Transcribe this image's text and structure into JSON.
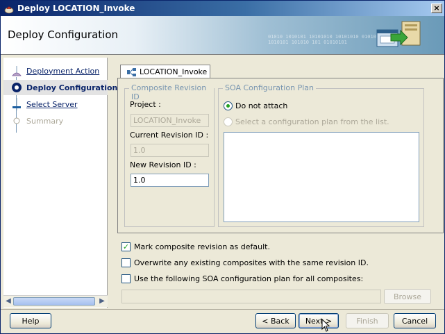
{
  "window": {
    "title": "Deploy LOCATION_Invoke",
    "close_label": "×"
  },
  "banner": {
    "title": "Deploy Configuration",
    "binary_text": "01010 1010101 10101010 10101010 01010 1010101 101010 101 01010101"
  },
  "steps": [
    {
      "label": "Deployment Action",
      "state": "link"
    },
    {
      "label": "Deploy Configuration",
      "state": "current"
    },
    {
      "label": "Select Server",
      "state": "link"
    },
    {
      "label": "Summary",
      "state": "muted"
    }
  ],
  "tab": {
    "label": "LOCATION_Invoke",
    "icon": "composite-icon"
  },
  "composite_revision": {
    "title": "Composite Revision ID",
    "project_label": "Project :",
    "project_value": "LOCATION_Invoke",
    "current_label": "Current Revision ID :",
    "current_value": "1.0",
    "new_label": "New Revision ID :",
    "new_value": "1.0"
  },
  "soa_plan": {
    "title": "SOA Configuration Plan",
    "option_do_not_attach": "Do not attach",
    "option_select_plan": "Select a configuration plan from the list.",
    "selected": "do_not_attach"
  },
  "options": {
    "mark_default": {
      "label": "Mark composite revision as default.",
      "checked": true
    },
    "overwrite": {
      "label": "Overwrite any existing composites with the same revision ID.",
      "checked": false
    },
    "use_plan": {
      "label": "Use the following SOA configuration plan for all composites:",
      "checked": false
    }
  },
  "browse_label": "Browse",
  "buttons": {
    "help": "Help",
    "back": "< Back",
    "next": "Next >",
    "finish": "Finish",
    "cancel": "Cancel"
  },
  "colors": {
    "title_bar": "#0a246a",
    "link": "#0a246a",
    "group_title": "#7895b0",
    "check_mark": "#21a121"
  }
}
